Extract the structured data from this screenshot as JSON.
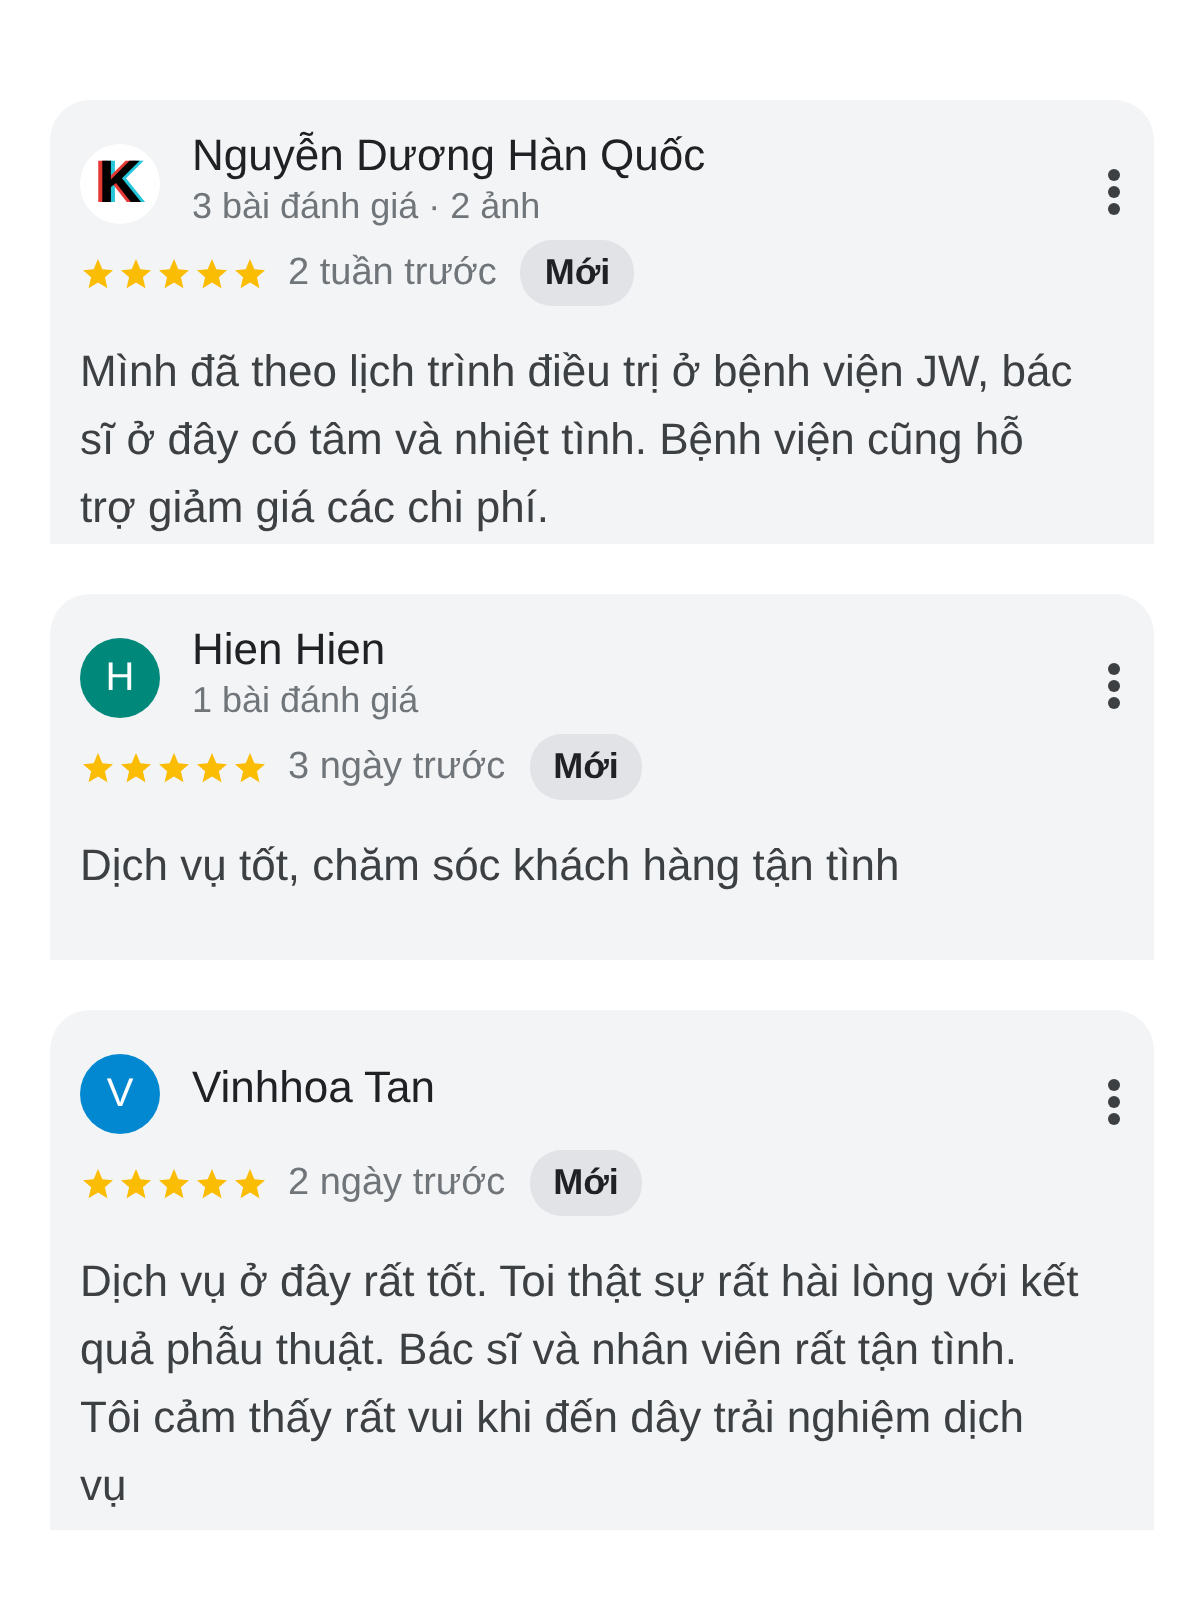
{
  "reviews": [
    {
      "avatar": {
        "kind": "logo",
        "letter": "K"
      },
      "name": "Nguyễn Dương Hàn Quốc",
      "meta": "3 bài đánh giá · 2 ảnh",
      "stars": 5,
      "time": "2 tuần trước",
      "badge": "Mới",
      "text": "Mình đã theo lịch trình điều trị ở bệnh viện JW, bác sĩ ở đây có tâm và nhiệt tình. Bệnh viện cũng hỗ trợ giảm giá các chi phí."
    },
    {
      "avatar": {
        "kind": "initial",
        "letter": "H",
        "color": "#00897b"
      },
      "name": "Hien Hien",
      "meta": "1 bài đánh giá",
      "stars": 5,
      "time": "3 ngày trước",
      "badge": "Mới",
      "text": "Dịch vụ tốt, chăm sóc khách hàng tận tình"
    },
    {
      "avatar": {
        "kind": "initial",
        "letter": "V",
        "color": "#0288d1"
      },
      "name": "Vinhhoa Tan",
      "stars": 5,
      "time": "2 ngày trước",
      "badge": "Mới",
      "text": "Dịch vụ ở đây rất tốt. Toi thật sự rất hài lòng với kết quả phẫu thuật. Bác sĩ và nhân viên rất tận tình. Tôi cảm thấy rất vui khi đến dây trải nghiệm dịch vụ"
    }
  ]
}
